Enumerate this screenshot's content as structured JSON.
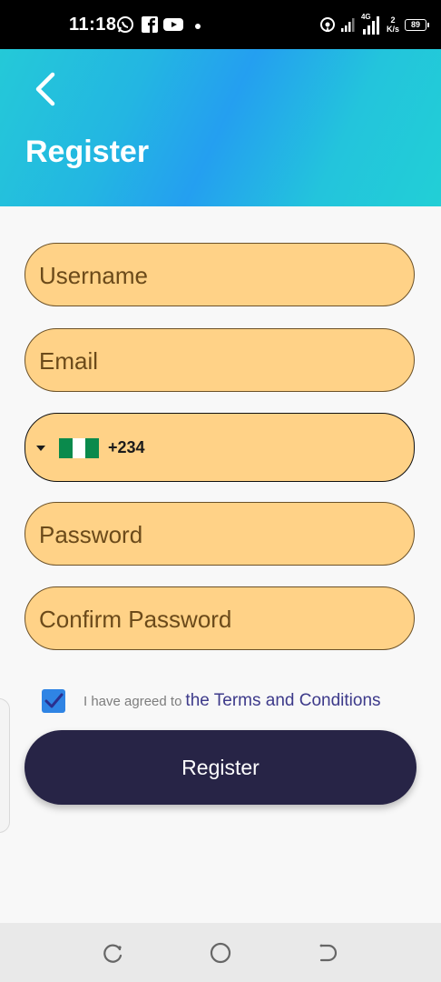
{
  "status_bar": {
    "time": "11:18",
    "net_speed_value": "2",
    "net_speed_unit": "K/s",
    "battery": "89",
    "signal_label": "4G"
  },
  "header": {
    "title": "Register",
    "back_icon": "chevron-left-icon"
  },
  "form": {
    "username_placeholder": "Username",
    "email_placeholder": "Email",
    "phone": {
      "country_flag": "nigeria-flag",
      "dial_code": "+234"
    },
    "password_placeholder": "Password",
    "confirm_password_placeholder": "Confirm Password",
    "terms": {
      "checked": true,
      "prefix": "I have agreed to",
      "link": "the Terms and Conditions"
    },
    "submit_label": "Register"
  },
  "colors": {
    "header_gradient": [
      "#24c9d8",
      "#249ff0",
      "#22cfd6"
    ],
    "field_fill": "#ffd287",
    "button": "#272446",
    "link": "#3d3a8a",
    "checkbox": "#2f84e4"
  },
  "nav_bar": {
    "icons": [
      "recents-icon",
      "home-icon",
      "back-icon"
    ]
  }
}
